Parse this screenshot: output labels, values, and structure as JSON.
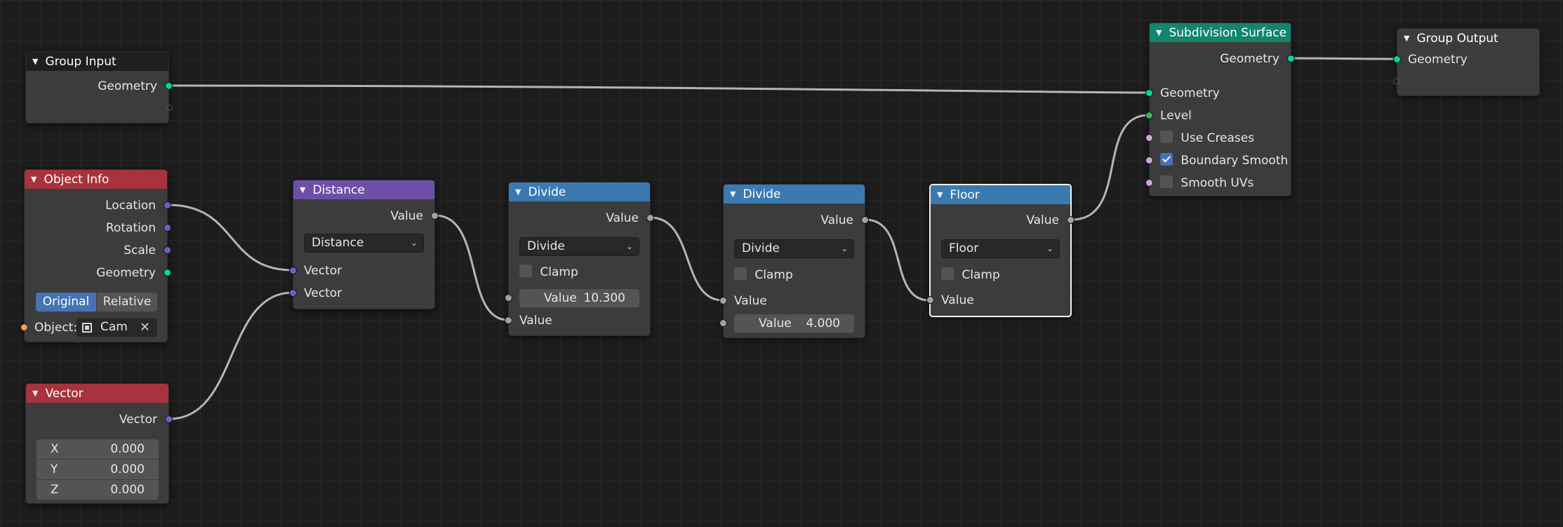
{
  "nodes": {
    "group_input": {
      "title": "Group Input",
      "outputs": [
        "Geometry"
      ]
    },
    "object_info": {
      "title": "Object Info",
      "outputs": [
        "Location",
        "Rotation",
        "Scale",
        "Geometry"
      ],
      "transform_modes": [
        "Original",
        "Relative"
      ],
      "selected_mode": "Original",
      "object_label": "Object:",
      "object_value": "Cam"
    },
    "vector": {
      "title": "Vector",
      "output": "Vector",
      "components": [
        {
          "label": "X",
          "value": "0.000"
        },
        {
          "label": "Y",
          "value": "0.000"
        },
        {
          "label": "Z",
          "value": "0.000"
        }
      ]
    },
    "distance": {
      "title": "Distance",
      "output": "Value",
      "operation": "Distance",
      "inputs": [
        "Vector",
        "Vector"
      ]
    },
    "divide_1": {
      "title": "Divide",
      "output": "Value",
      "operation": "Divide",
      "clamp_label": "Clamp",
      "clamp": false,
      "input_field": {
        "label": "Value",
        "value": "10.300"
      },
      "input_socket": "Value"
    },
    "divide_2": {
      "title": "Divide",
      "output": "Value",
      "operation": "Divide",
      "clamp_label": "Clamp",
      "clamp": false,
      "input_socket": "Value",
      "input_field": {
        "label": "Value",
        "value": "4.000"
      }
    },
    "floor": {
      "title": "Floor",
      "output": "Value",
      "operation": "Floor",
      "clamp_label": "Clamp",
      "clamp": false,
      "input_socket": "Value"
    },
    "subdivision_surface": {
      "title": "Subdivision Surface",
      "output": "Geometry",
      "inputs": [
        "Geometry",
        "Level"
      ],
      "options": [
        {
          "label": "Use Creases",
          "checked": false
        },
        {
          "label": "Boundary Smooth",
          "checked": true
        },
        {
          "label": "Smooth UVs",
          "checked": false
        }
      ]
    },
    "group_output": {
      "title": "Group Output",
      "inputs": [
        "Geometry"
      ]
    }
  },
  "colors": {
    "geometry_socket": "#00d6a3",
    "vector_socket": "#6363c7",
    "float_socket": "#a1a1a1",
    "integer_socket": "#35b54a",
    "boolean_socket": "#cca6d6",
    "object_socket": "#ed9e5c",
    "input_header": "#a8323d",
    "vector_header": "#6d4fa8",
    "converter_header": "#3a7ab0",
    "geometry_header": "#12866c",
    "link": "#b5b5b5"
  }
}
